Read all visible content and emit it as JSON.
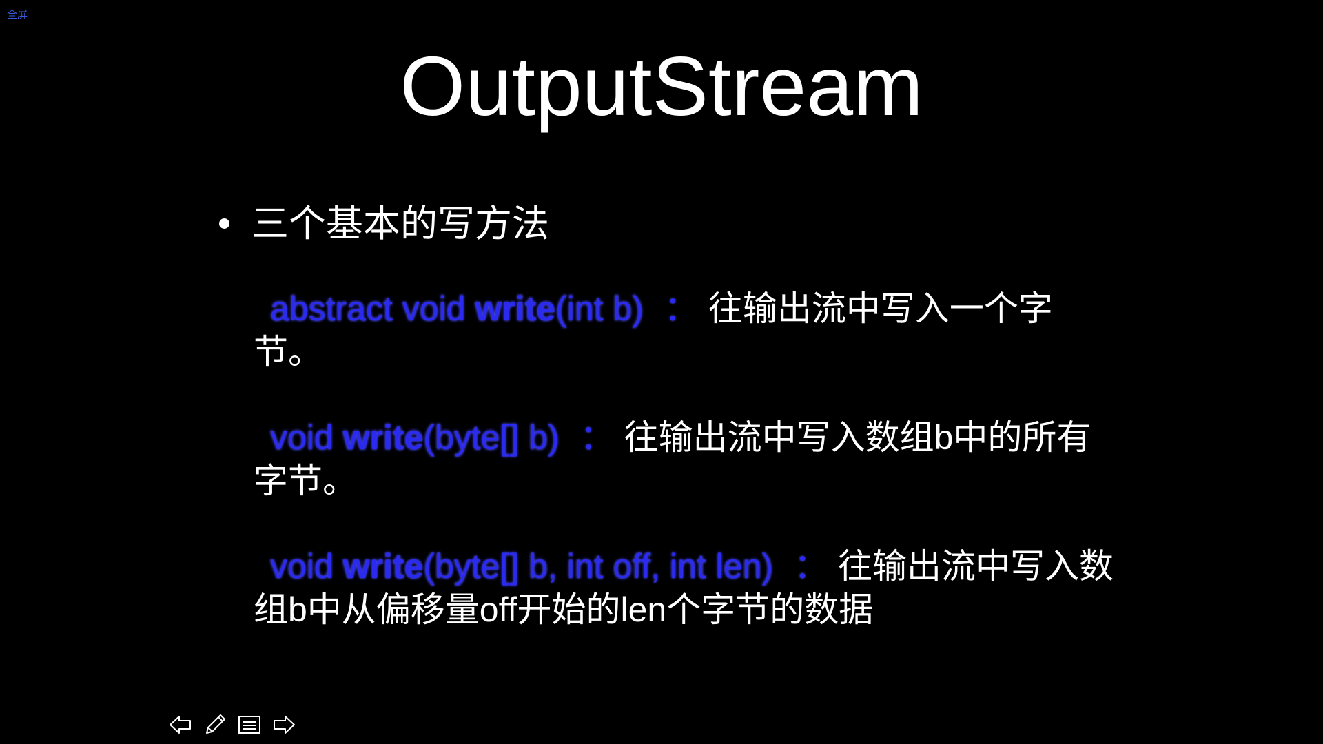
{
  "header": {
    "fullscreen_label": "全屏"
  },
  "slide": {
    "title": "OutputStream",
    "bullet_text": "三个基本的写方法",
    "methods": [
      {
        "code_prefix": "abstract void ",
        "code_method": "write",
        "code_suffix": "(int b)",
        "colon": "：",
        "description": "往输出流中写入一个字节。"
      },
      {
        "code_prefix": "void ",
        "code_method": "write",
        "code_suffix": "(byte[] b)",
        "colon": "：",
        "description": "往输出流中写入数组b中的所有字节。"
      },
      {
        "code_prefix": "void ",
        "code_method": "write",
        "code_suffix": "(byte[] b, int off, int len)",
        "colon": "：",
        "description": "往输出流中写入数组b中从偏移量off开始的len个字节的数据"
      }
    ]
  },
  "toolbar": {
    "icons": [
      "arrow-left-icon",
      "pencil-icon",
      "menu-icon",
      "arrow-right-icon"
    ]
  },
  "colors": {
    "background": "#000000",
    "text": "#ffffff",
    "code": "#2b2bf0",
    "fullscreen_link": "#3a5bd9"
  }
}
